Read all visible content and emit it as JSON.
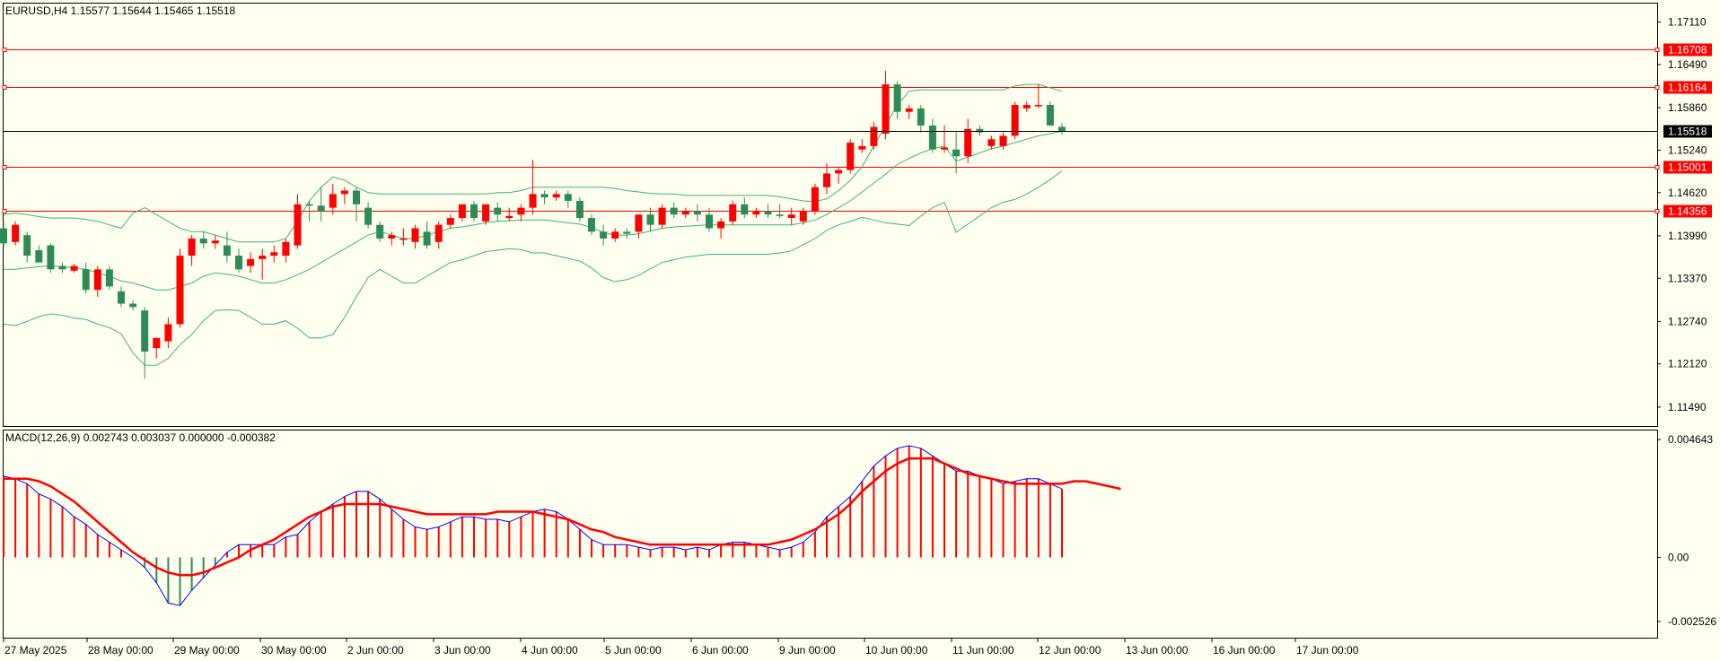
{
  "header": {
    "symbol_line": "EURUSD,H4  1.15577 1.15644 1.15465 1.15518"
  },
  "macd": {
    "title": "MACD(12,26,9) 0.002743 0.003037 0.000000 -0.000382",
    "axis_labels": [
      "0.004643",
      "0.00",
      "-0.002526"
    ]
  },
  "colors": {
    "background": "#fffff0",
    "bull": "#2e8b57",
    "bear": "#ff0000",
    "bands": "#3cb371",
    "hline": "#ff0000",
    "price_line": "#000000",
    "macd_line": "#0000ff",
    "signal_line": "#ff0000"
  },
  "chart_data": [
    {
      "type": "candlestick",
      "title": "EURUSD,H4",
      "ohlc_current": {
        "open": 1.15577,
        "high": 1.15644,
        "low": 1.15465,
        "close": 1.15518
      },
      "y_ticks": [
        "1.17110",
        "1.16490",
        "1.15860",
        "1.15240",
        "1.14620",
        "1.13990",
        "1.13370",
        "1.12740",
        "1.12120",
        "1.11490"
      ],
      "ylim": [
        1.112,
        1.1738
      ],
      "x_ticks": [
        "27 May 2025",
        "28 May 00:00",
        "29 May 00:00",
        "30 May 00:00",
        "2 Jun 00:00",
        "3 Jun 00:00",
        "4 Jun 00:00",
        "5 Jun 00:00",
        "6 Jun 00:00",
        "9 Jun 00:00",
        "10 Jun 00:00",
        "11 Jun 00:00",
        "12 Jun 00:00",
        "13 Jun 00:00",
        "16 Jun 00:00",
        "17 Jun 00:00"
      ],
      "horizontal_levels": [
        {
          "value": 1.16708,
          "label": "1.16708",
          "color": "red"
        },
        {
          "value": 1.16164,
          "label": "1.16164",
          "color": "red"
        },
        {
          "value": 1.15001,
          "label": "1.15001",
          "color": "red"
        },
        {
          "value": 1.14356,
          "label": "1.14356",
          "color": "red"
        }
      ],
      "current_price": {
        "value": 1.15518,
        "label": "1.15518"
      },
      "candles": [
        [
          1.141,
          1.142,
          1.138,
          1.1388
        ],
        [
          1.139,
          1.142,
          1.1385,
          1.1415
        ],
        [
          1.14,
          1.1405,
          1.136,
          1.137
        ],
        [
          1.1378,
          1.1385,
          1.1365,
          1.136
        ],
        [
          1.1385,
          1.1388,
          1.1345,
          1.135
        ],
        [
          1.1355,
          1.136,
          1.1345,
          1.135
        ],
        [
          1.1348,
          1.1358,
          1.1345,
          1.1355
        ],
        [
          1.135,
          1.136,
          1.1315,
          1.132
        ],
        [
          1.132,
          1.1355,
          1.131,
          1.135
        ],
        [
          1.135,
          1.1355,
          1.132,
          1.1325
        ],
        [
          1.1318,
          1.1325,
          1.1295,
          1.13
        ],
        [
          1.13,
          1.1305,
          1.129,
          1.1295
        ],
        [
          1.129,
          1.1295,
          1.119,
          1.123
        ],
        [
          1.1235,
          1.125,
          1.122,
          1.125
        ],
        [
          1.1245,
          1.128,
          1.1235,
          1.127
        ],
        [
          1.127,
          1.138,
          1.1265,
          1.137
        ],
        [
          1.137,
          1.14,
          1.1355,
          1.1395
        ],
        [
          1.1395,
          1.1405,
          1.138,
          1.1388
        ],
        [
          1.1388,
          1.14,
          1.138,
          1.1392
        ],
        [
          1.1385,
          1.1405,
          1.136,
          1.137
        ],
        [
          1.137,
          1.138,
          1.1345,
          1.135
        ],
        [
          1.1355,
          1.1375,
          1.1345,
          1.1365
        ],
        [
          1.1365,
          1.138,
          1.1335,
          1.137
        ],
        [
          1.137,
          1.1385,
          1.136,
          1.1375
        ],
        [
          1.137,
          1.1395,
          1.136,
          1.139
        ],
        [
          1.1385,
          1.146,
          1.138,
          1.1445
        ],
        [
          1.1445,
          1.145,
          1.142,
          1.1443
        ],
        [
          1.1443,
          1.147,
          1.142,
          1.1435
        ],
        [
          1.144,
          1.1475,
          1.143,
          1.146
        ],
        [
          1.146,
          1.147,
          1.1445,
          1.1465
        ],
        [
          1.1465,
          1.147,
          1.142,
          1.1445
        ],
        [
          1.144,
          1.1448,
          1.141,
          1.1415
        ],
        [
          1.1415,
          1.142,
          1.139,
          1.1395
        ],
        [
          1.1395,
          1.1405,
          1.1385,
          1.14
        ],
        [
          1.1395,
          1.141,
          1.1385,
          1.1395
        ],
        [
          1.139,
          1.1415,
          1.138,
          1.141
        ],
        [
          1.1405,
          1.142,
          1.138,
          1.1385
        ],
        [
          1.139,
          1.142,
          1.138,
          1.1415
        ],
        [
          1.1415,
          1.143,
          1.141,
          1.1425
        ],
        [
          1.1425,
          1.144,
          1.142,
          1.1445
        ],
        [
          1.1445,
          1.145,
          1.142,
          1.1425
        ],
        [
          1.142,
          1.144,
          1.1415,
          1.1445
        ],
        [
          1.144,
          1.1448,
          1.142,
          1.143
        ],
        [
          1.1425,
          1.144,
          1.142,
          1.1428
        ],
        [
          1.143,
          1.1445,
          1.142,
          1.144
        ],
        [
          1.144,
          1.151,
          1.143,
          1.146
        ],
        [
          1.146,
          1.1465,
          1.1445,
          1.1455
        ],
        [
          1.1455,
          1.1465,
          1.145,
          1.146
        ],
        [
          1.146,
          1.1465,
          1.144,
          1.145
        ],
        [
          1.145,
          1.1455,
          1.142,
          1.1425
        ],
        [
          1.1425,
          1.143,
          1.14,
          1.1405
        ],
        [
          1.1405,
          1.1415,
          1.1385,
          1.1395
        ],
        [
          1.1395,
          1.141,
          1.139,
          1.1405
        ],
        [
          1.1405,
          1.141,
          1.1395,
          1.1402
        ],
        [
          1.1405,
          1.142,
          1.1395,
          1.143
        ],
        [
          1.143,
          1.144,
          1.1405,
          1.1415
        ],
        [
          1.1415,
          1.1445,
          1.141,
          1.144
        ],
        [
          1.144,
          1.1448,
          1.1425,
          1.143
        ],
        [
          1.143,
          1.144,
          1.1425,
          1.1435
        ],
        [
          1.1435,
          1.1445,
          1.142,
          1.143
        ],
        [
          1.143,
          1.144,
          1.1405,
          1.141
        ],
        [
          1.141,
          1.1425,
          1.1395,
          1.142
        ],
        [
          1.142,
          1.145,
          1.1415,
          1.1445
        ],
        [
          1.1445,
          1.1455,
          1.1425,
          1.143
        ],
        [
          1.143,
          1.144,
          1.1425,
          1.1435
        ],
        [
          1.1435,
          1.1445,
          1.1425,
          1.143
        ],
        [
          1.143,
          1.1445,
          1.1425,
          1.1428
        ],
        [
          1.1425,
          1.144,
          1.1415,
          1.143
        ],
        [
          1.142,
          1.144,
          1.1415,
          1.1435
        ],
        [
          1.1435,
          1.1475,
          1.143,
          1.147
        ],
        [
          1.147,
          1.1505,
          1.146,
          1.149
        ],
        [
          1.149,
          1.15,
          1.1475,
          1.1495
        ],
        [
          1.1495,
          1.154,
          1.149,
          1.1535
        ],
        [
          1.1525,
          1.154,
          1.152,
          1.153
        ],
        [
          1.153,
          1.1565,
          1.1525,
          1.1558
        ],
        [
          1.1548,
          1.164,
          1.154,
          1.162
        ],
        [
          1.162,
          1.1625,
          1.157,
          1.158
        ],
        [
          1.158,
          1.159,
          1.157,
          1.1585
        ],
        [
          1.1585,
          1.159,
          1.155,
          1.156
        ],
        [
          1.156,
          1.157,
          1.152,
          1.1525
        ],
        [
          1.1525,
          1.156,
          1.152,
          1.1528
        ],
        [
          1.1525,
          1.155,
          1.149,
          1.1515
        ],
        [
          1.1515,
          1.157,
          1.1505,
          1.1555
        ],
        [
          1.1555,
          1.156,
          1.1545,
          1.155
        ],
        [
          1.153,
          1.1545,
          1.1525,
          1.154
        ],
        [
          1.153,
          1.155,
          1.1525,
          1.1545
        ],
        [
          1.1545,
          1.1595,
          1.154,
          1.159
        ],
        [
          1.1585,
          1.1595,
          1.158,
          1.159
        ],
        [
          1.159,
          1.162,
          1.1585,
          1.159
        ],
        [
          1.159,
          1.1595,
          1.156,
          1.156
        ],
        [
          1.1558,
          1.1564,
          1.1547,
          1.1552
        ]
      ],
      "bollinger": {
        "upper": [
          1.143,
          1.1432,
          1.143,
          1.1427,
          1.1425,
          1.1425,
          1.1425,
          1.1423,
          1.142,
          1.1415,
          1.141,
          1.1432,
          1.144,
          1.143,
          1.142,
          1.141,
          1.1405,
          1.1405,
          1.14,
          1.1395,
          1.139,
          1.139,
          1.139,
          1.139,
          1.1395,
          1.142,
          1.145,
          1.147,
          1.1485,
          1.148,
          1.147,
          1.1462,
          1.146,
          1.146,
          1.146,
          1.146,
          1.146,
          1.146,
          1.146,
          1.146,
          1.146,
          1.146,
          1.1462,
          1.1462,
          1.1465,
          1.147,
          1.147,
          1.147,
          1.147,
          1.147,
          1.147,
          1.147,
          1.1468,
          1.1465,
          1.1463,
          1.1461,
          1.146,
          1.146,
          1.1458,
          1.1458,
          1.1458,
          1.1458,
          1.1458,
          1.1458,
          1.1458,
          1.1458,
          1.1456,
          1.1453,
          1.145,
          1.1449,
          1.1453,
          1.1465,
          1.148,
          1.15,
          1.153,
          1.156,
          1.159,
          1.161,
          1.1612,
          1.1612,
          1.1612,
          1.1612,
          1.1612,
          1.1612,
          1.1612,
          1.1612,
          1.1618,
          1.162,
          1.162,
          1.1615,
          1.161
        ],
        "middle": [
          1.135,
          1.135,
          1.1352,
          1.1354,
          1.1355,
          1.1354,
          1.1352,
          1.135,
          1.1345,
          1.134,
          1.1333,
          1.133,
          1.1325,
          1.132,
          1.132,
          1.1325,
          1.133,
          1.134,
          1.1345,
          1.1343,
          1.134,
          1.1335,
          1.133,
          1.133,
          1.1335,
          1.1342,
          1.135,
          1.136,
          1.137,
          1.138,
          1.139,
          1.14,
          1.1405,
          1.14,
          1.1395,
          1.1395,
          1.14,
          1.1405,
          1.141,
          1.1412,
          1.1415,
          1.1418,
          1.142,
          1.1421,
          1.1422,
          1.1422,
          1.1422,
          1.142,
          1.1418,
          1.1416,
          1.1411,
          1.1404,
          1.14,
          1.14,
          1.1402,
          1.1406,
          1.141,
          1.1412,
          1.1413,
          1.1414,
          1.1415,
          1.1415,
          1.1415,
          1.1415,
          1.1415,
          1.1415,
          1.1415,
          1.1415,
          1.1418,
          1.1422,
          1.143,
          1.144,
          1.145,
          1.1463,
          1.1476,
          1.1489,
          1.1503,
          1.1512,
          1.152,
          1.1526,
          1.153,
          1.1508,
          1.1514,
          1.152,
          1.1526,
          1.153,
          1.1535,
          1.154,
          1.1545,
          1.1548,
          1.1552
        ]
      }
    },
    {
      "type": "macd",
      "title": "MACD(12,26,9)",
      "params": [
        12,
        26,
        9
      ],
      "current": {
        "main": 0.002743,
        "signal": 0.003037,
        "zero": 0.0,
        "hist": -0.000382
      },
      "y_ticks": [
        "0.004643",
        "0.00",
        "-0.002526"
      ],
      "ylim": [
        -0.0032,
        0.005
      ],
      "main": [
        0.0032,
        0.0031,
        0.0029,
        0.0025,
        0.0023,
        0.002,
        0.0016,
        0.0013,
        0.0009,
        0.0006,
        0.0003,
        0.0,
        -0.0004,
        -0.001,
        -0.0018,
        -0.0019,
        -0.0013,
        -0.0008,
        -0.0003,
        0.0002,
        0.0005,
        0.0005,
        0.0005,
        0.0005,
        0.0008,
        0.0009,
        0.0014,
        0.0018,
        0.0021,
        0.0024,
        0.0026,
        0.0026,
        0.0023,
        0.0019,
        0.0015,
        0.0012,
        0.0011,
        0.0012,
        0.0014,
        0.0016,
        0.0016,
        0.0015,
        0.0015,
        0.0014,
        0.0016,
        0.0018,
        0.0019,
        0.0018,
        0.0015,
        0.0011,
        0.0007,
        0.0005,
        0.0005,
        0.0005,
        0.0004,
        0.0003,
        0.0004,
        0.0004,
        0.0003,
        0.0004,
        0.0003,
        0.0005,
        0.0006,
        0.0006,
        0.0005,
        0.0004,
        0.0003,
        0.0004,
        0.0006,
        0.001,
        0.0016,
        0.002,
        0.0024,
        0.003,
        0.0036,
        0.004,
        0.0043,
        0.0044,
        0.0043,
        0.004,
        0.0037,
        0.0034,
        0.0034,
        0.0032,
        0.0031,
        0.0029,
        0.003,
        0.0031,
        0.0031,
        0.0029,
        0.0027
      ],
      "signal": [
        0.0031,
        0.0031,
        0.0031,
        0.003,
        0.0028,
        0.0025,
        0.0022,
        0.0018,
        0.0014,
        0.001,
        0.0006,
        0.0002,
        -0.0001,
        -0.0004,
        -0.0006,
        -0.0007,
        -0.0007,
        -0.0006,
        -0.0004,
        -0.0002,
        0.0,
        0.0003,
        0.0005,
        0.0007,
        0.001,
        0.0013,
        0.0016,
        0.0018,
        0.002,
        0.0021,
        0.0021,
        0.0021,
        0.0021,
        0.002,
        0.0019,
        0.0018,
        0.0017,
        0.0017,
        0.0017,
        0.0017,
        0.0017,
        0.0017,
        0.0018,
        0.0018,
        0.0018,
        0.0018,
        0.0017,
        0.0016,
        0.0015,
        0.0013,
        0.0011,
        0.001,
        0.0008,
        0.0007,
        0.0006,
        0.0005,
        0.0005,
        0.0005,
        0.0005,
        0.0005,
        0.0005,
        0.0005,
        0.0005,
        0.0005,
        0.0005,
        0.0005,
        0.0006,
        0.0007,
        0.0009,
        0.0011,
        0.0014,
        0.0017,
        0.0021,
        0.0026,
        0.003,
        0.0034,
        0.0037,
        0.0039,
        0.0039,
        0.0039,
        0.0037,
        0.0035,
        0.0033,
        0.0032,
        0.0031,
        0.003,
        0.0029,
        0.0029,
        0.0029,
        0.0029,
        0.0029,
        0.003,
        0.003,
        0.0029,
        0.0028,
        0.0027
      ]
    }
  ]
}
